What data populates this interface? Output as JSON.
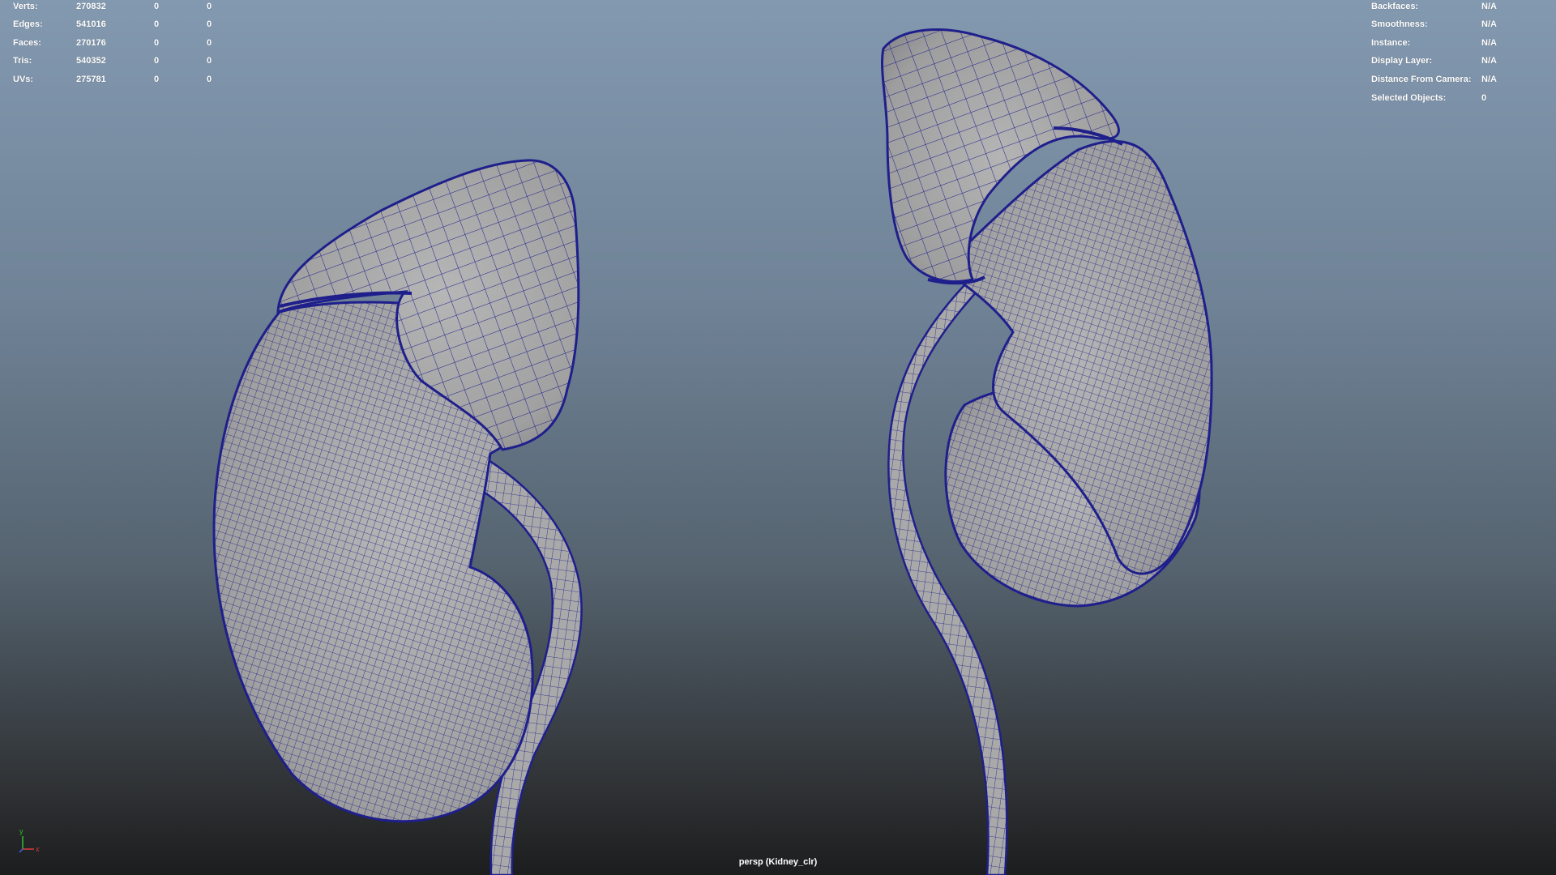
{
  "hud_left": {
    "rows": [
      {
        "label": "Verts:",
        "count": "270832",
        "selected": "0",
        "component": "0"
      },
      {
        "label": "Edges:",
        "count": "541016",
        "selected": "0",
        "component": "0"
      },
      {
        "label": "Faces:",
        "count": "270176",
        "selected": "0",
        "component": "0"
      },
      {
        "label": "Tris:",
        "count": "540352",
        "selected": "0",
        "component": "0"
      },
      {
        "label": "UVs:",
        "count": "275781",
        "selected": "0",
        "component": "0"
      }
    ]
  },
  "hud_right": {
    "rows": [
      {
        "label": "Backfaces:",
        "value": "N/A"
      },
      {
        "label": "Smoothness:",
        "value": "N/A"
      },
      {
        "label": "Instance:",
        "value": "N/A"
      },
      {
        "label": "Display Layer:",
        "value": "N/A"
      },
      {
        "label": "Distance From Camera:",
        "value": "N/A"
      },
      {
        "label": "Selected Objects:",
        "value": "0"
      }
    ]
  },
  "viewport": {
    "camera_label": "persp (Kidney_clr)",
    "axis": {
      "y": "y",
      "x": "x"
    },
    "objects": [
      "kidney-front-view",
      "kidney-back-view"
    ]
  },
  "colors": {
    "wireframe": "#1f1f8c",
    "mesh_fill": "#a3a3a3",
    "axis_y": "#2fb82f",
    "axis_x": "#d23a3a",
    "axis_z": "#3a5bd2"
  }
}
